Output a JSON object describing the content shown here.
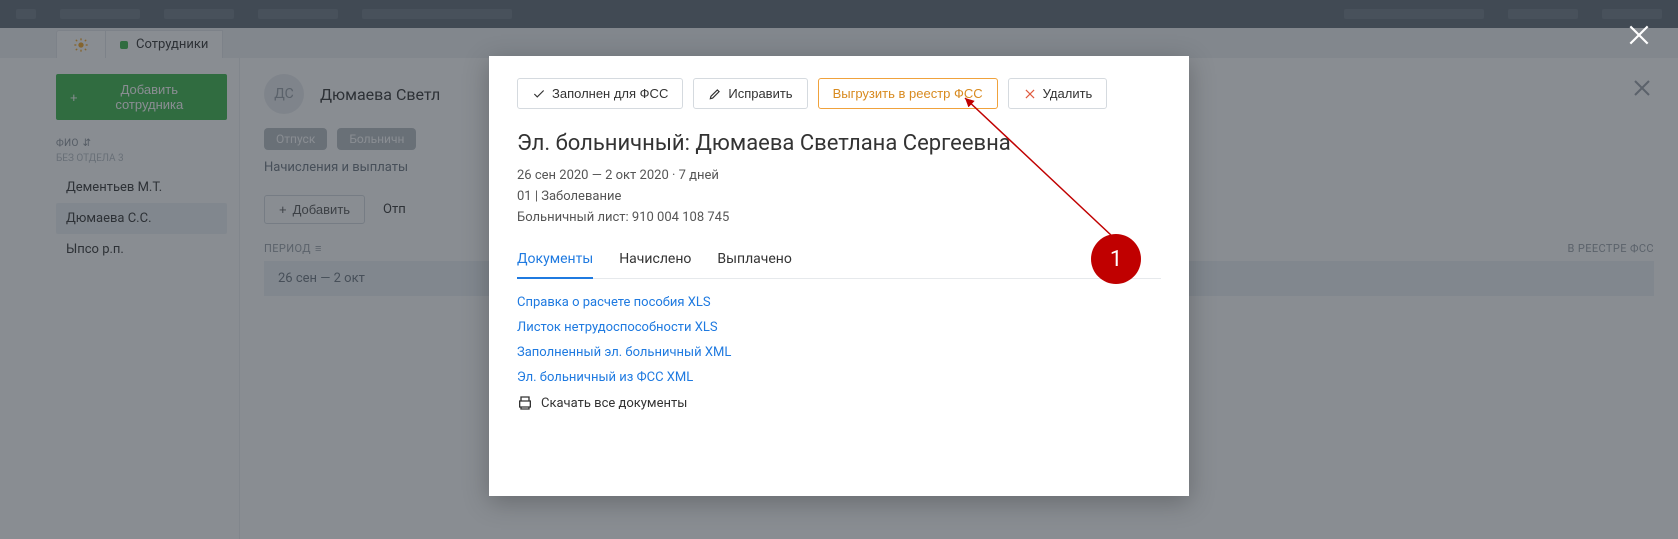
{
  "tab": {
    "label": "Сотрудники"
  },
  "sidebar": {
    "add_label": "Добавить сотрудника",
    "fio_label": "ФИО",
    "section_label": "БЕЗ ОТДЕЛА 3",
    "people": [
      "Дементьев М.Т.",
      "Дюмаева С.С.",
      "Ыпсо р.п."
    ]
  },
  "employee": {
    "initials": "ДС",
    "name": "Дюмаева Светл",
    "pill1": "Отпуск",
    "pill2": "Больничн",
    "note": "Начисления и выплаты",
    "add_btn": "Добавить",
    "tab_from": "Отп",
    "col_period": "ПЕРИОД",
    "col_reg": "В РЕЕСТРЕ ФСС",
    "row_period": "26 сен — 2 окт"
  },
  "modal": {
    "btn_filled": "Заполнен для ФСС",
    "btn_fix": "Исправить",
    "btn_export": "Выгрузить в реестр ФСС",
    "btn_delete": "Удалить",
    "title": "Эл. больничный: Дюмаева Светлана Сергеевна",
    "dates": "26 сен 2020 — 2 окт 2020 · 7 дней",
    "reason": "01 | Заболевание",
    "sheet": "Больничный лист: 910 004 108 745",
    "tabs": [
      "Документы",
      "Начислено",
      "Выплачено"
    ],
    "docs": [
      "Справка о расчете пособия XLS",
      "Листок нетрудоспособности XLS",
      "Заполненный эл. больничный XML",
      "Эл. больничный из ФСС XML"
    ],
    "download_all": "Скачать все документы"
  },
  "annotation": {
    "n": "1"
  }
}
